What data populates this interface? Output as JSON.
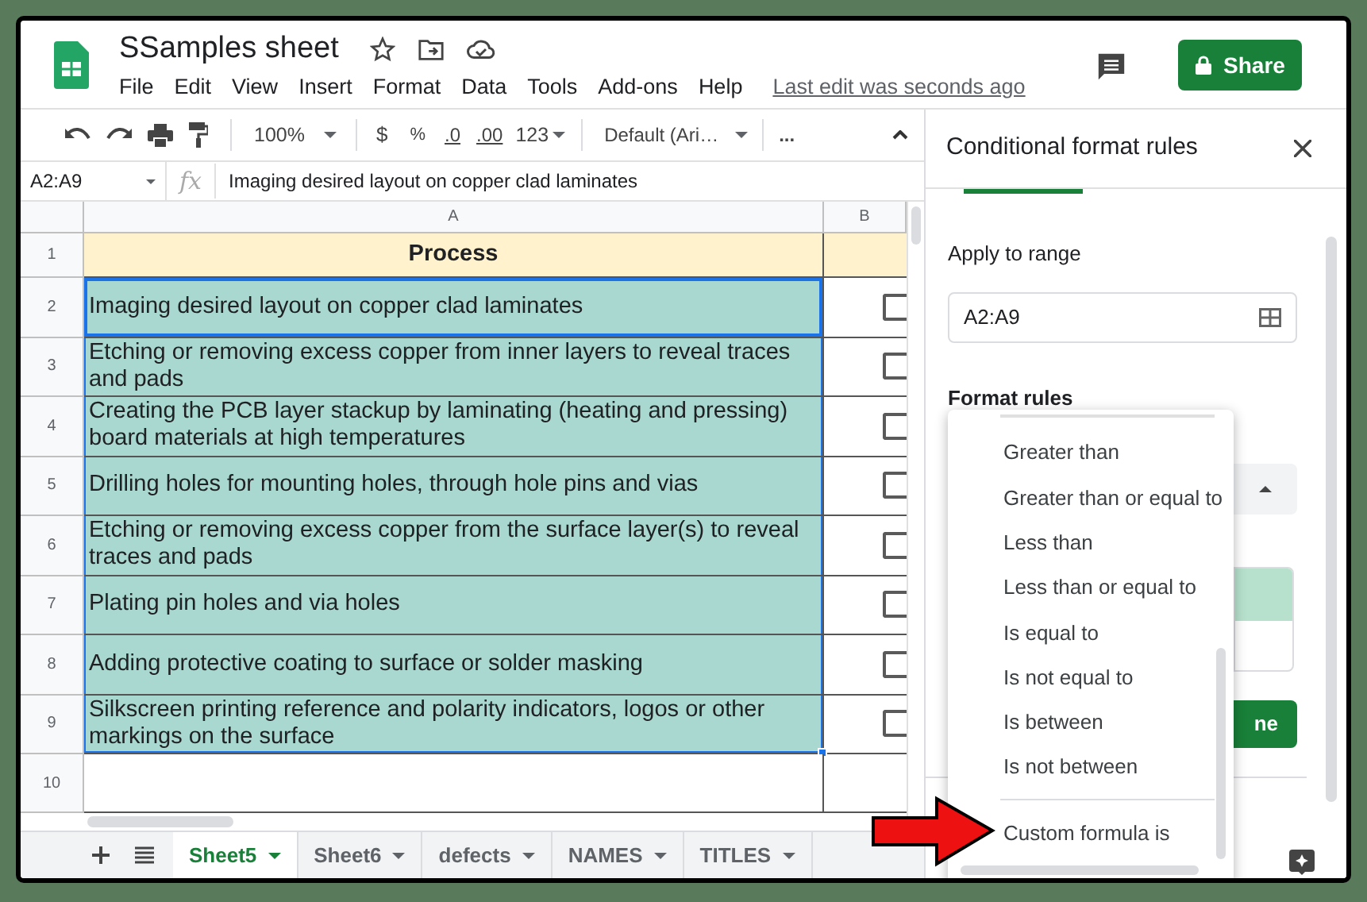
{
  "app": {
    "title": "SSamples sheet",
    "menu": [
      "File",
      "Edit",
      "View",
      "Insert",
      "Format",
      "Data",
      "Tools",
      "Add-ons",
      "Help"
    ],
    "last_edit": "Last edit was seconds ago",
    "share": "Share"
  },
  "toolbar": {
    "zoom": "100%",
    "currency": "$",
    "percent": "%",
    "decrease_decimals": ".0",
    "increase_decimals": ".00",
    "number_format": "123",
    "font": "Default (Ari…",
    "more": "..."
  },
  "formula_bar": {
    "name_box": "A2:A9",
    "fx": "fx",
    "content": "Imaging desired layout on copper clad laminates"
  },
  "grid": {
    "columns": [
      "A",
      "B"
    ],
    "rows": [
      {
        "number": "1",
        "kind": "header",
        "text": "Process",
        "selected": false
      },
      {
        "number": "2",
        "kind": "data",
        "text": "Imaging desired layout on copper clad laminates",
        "checked": false,
        "selected": true
      },
      {
        "number": "3",
        "kind": "data",
        "text": "Etching or removing excess copper from inner layers to reveal traces and pads",
        "checked": false,
        "selected": true
      },
      {
        "number": "4",
        "kind": "data",
        "text": "Creating the PCB layer stackup by laminating (heating and pressing) board materials at high temperatures",
        "checked": false,
        "selected": true
      },
      {
        "number": "5",
        "kind": "data",
        "text": "Drilling holes for mounting holes, through hole pins and vias",
        "checked": false,
        "selected": true
      },
      {
        "number": "6",
        "kind": "data",
        "text": "Etching or removing excess copper from the surface layer(s) to reveal traces and pads",
        "checked": false,
        "selected": true
      },
      {
        "number": "7",
        "kind": "data",
        "text": "Plating pin holes and via holes",
        "checked": false,
        "selected": true
      },
      {
        "number": "8",
        "kind": "data",
        "text": "Adding protective coating to surface or solder masking",
        "checked": false,
        "selected": true
      },
      {
        "number": "9",
        "kind": "data",
        "text": "Silkscreen printing reference and polarity indicators, logos or other markings on the surface",
        "checked": false,
        "selected": true
      },
      {
        "number": "10",
        "kind": "empty",
        "selected": false
      }
    ]
  },
  "sheet_tabs": [
    {
      "label": "Sheet5",
      "selected": true
    },
    {
      "label": "Sheet6",
      "selected": false
    },
    {
      "label": "defects",
      "selected": false
    },
    {
      "label": "NAMES",
      "selected": false
    },
    {
      "label": "TITLES",
      "selected": false
    }
  ],
  "panel": {
    "title": "Conditional format rules",
    "apply_to_range_label": "Apply to range",
    "range": "A2:A9",
    "format_rules_label": "Format rules",
    "done": "ne"
  },
  "condition_menu": {
    "items": [
      {
        "label": "Greater than",
        "kind": "option"
      },
      {
        "label": "Greater than or equal to",
        "kind": "option"
      },
      {
        "label": "Less than",
        "kind": "option"
      },
      {
        "label": "Less than or equal to",
        "kind": "option"
      },
      {
        "label": "Is equal to",
        "kind": "option"
      },
      {
        "label": "Is not equal to",
        "kind": "option"
      },
      {
        "label": "Is between",
        "kind": "option"
      },
      {
        "label": "Is not between",
        "kind": "option"
      },
      {
        "label": "Custom formula is",
        "kind": "separated"
      }
    ]
  }
}
